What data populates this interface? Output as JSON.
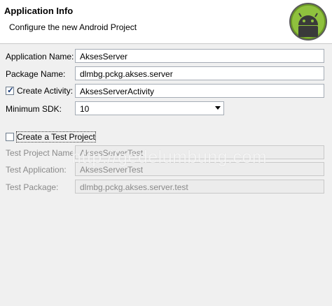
{
  "header": {
    "title": "Application Info",
    "description": "Configure the new Android Project"
  },
  "form": {
    "application_name": {
      "label": "Application Name:",
      "value": "AksesServer"
    },
    "package_name": {
      "label": "Package Name:",
      "value": "dlmbg.pckg.akses.server"
    },
    "create_activity": {
      "label": "Create Activity:",
      "checked": true,
      "value": "AksesServerActivity"
    },
    "minimum_sdk": {
      "label": "Minimum SDK:",
      "value": "10"
    }
  },
  "test_project": {
    "checkbox_label": "Create a Test Project",
    "checked": false,
    "name": {
      "label": "Test Project Name:",
      "value": "AksesServerTest"
    },
    "application": {
      "label": "Test Application:",
      "value": "AksesServerTest"
    },
    "package": {
      "label": "Test Package:",
      "value": "dlmbg.pckg.akses.server.test"
    }
  },
  "watermark": "http://gedelumbung.com",
  "icons": {
    "logo": "android-logo-icon",
    "check": "checkmark-icon",
    "dropdown": "chevron-down-icon"
  }
}
